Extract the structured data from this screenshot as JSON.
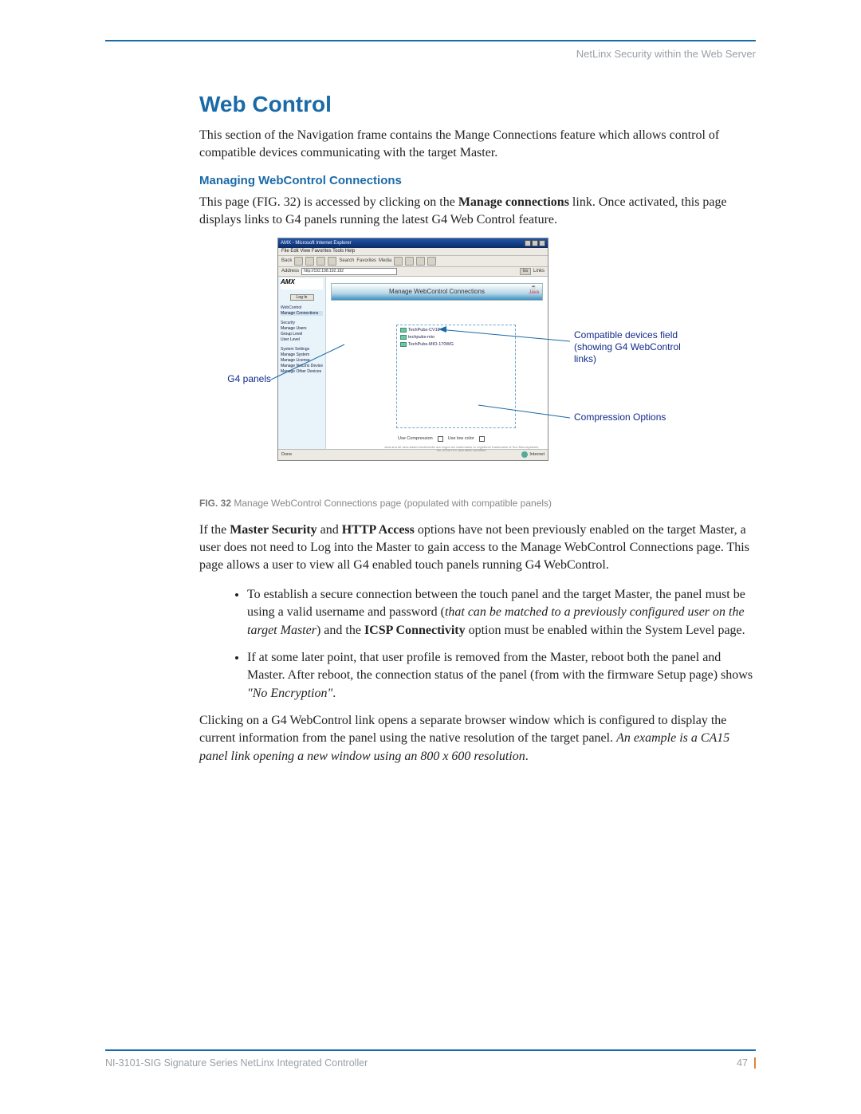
{
  "header": {
    "breadcrumb": "NetLinx Security within the Web Server"
  },
  "h1": "Web Control",
  "intro": "This section of the Navigation frame contains the Mange Connections feature which allows control of compatible devices communicating with the target Master.",
  "h2": "Managing WebControl Connections",
  "para2_pre": "This page (FIG. 32) is accessed by clicking on the ",
  "para2_bold": "Manage connections",
  "para2_post": " link. Once activated, this page displays links to G4 panels running the latest G4 Web Control feature.",
  "figure": {
    "browser": {
      "title": "AMX - Microsoft Internet Explorer",
      "menubar": "File   Edit   View   Favorites   Tools   Help",
      "toolbar_back": "Back",
      "toolbar_search": "Search",
      "toolbar_favorites": "Favorites",
      "toolbar_media": "Media",
      "address_label": "Address",
      "address_url": "http://192.198.192.192",
      "go": "Go",
      "links": "Links"
    },
    "page": {
      "logo": "AMX",
      "banner_title": "Manage WebControl Connections",
      "java_label": "Java",
      "left_login": "Log In",
      "left_section_web": "WebControl",
      "left_item_manage": "Manage Connections",
      "left_section_security": "Security",
      "left_items_security": [
        "Manage Users",
        "Group Level",
        "User Level"
      ],
      "left_section_system": "System Settings",
      "left_items_system": [
        "Manage System",
        "Manage License",
        "Manage NetLinx Devices",
        "Manage Other Devices"
      ],
      "devices": [
        "TechPubs-CV10",
        "techpubs-mio",
        "TechPubs-MIO-170WG"
      ],
      "compress_label_1": "Use Compression",
      "compress_label_2": "Use low color",
      "fineprint": "Java and all Java-based trademarks and logos are trademarks or registered trademarks of Sun Microsystems, Inc. in the U.S. and other countries."
    },
    "status": {
      "left": "Done",
      "right": "Internet"
    },
    "callouts": {
      "left": "G4 panels",
      "right1": "Compatible devices field (showing G4 WebControl links)",
      "right2": "Compression Options"
    },
    "caption_bold": "FIG. 32",
    "caption_text": "  Manage WebControl Connections page (populated with compatible panels)"
  },
  "para3": {
    "pre": "If the ",
    "b1": "Master Security",
    "mid1": " and ",
    "b2": "HTTP Access",
    "post": " options have not been previously enabled on the target Master, a user does not need to Log into the Master to gain access to the Manage WebControl Connections page. This page allows a user to view all G4 enabled touch panels running G4 WebControl."
  },
  "bullets": [
    {
      "pre": "To establish a secure connection between the touch panel and the target Master, the panel must be using a valid username and password (",
      "em1": "that can be matched to a previously configured user on the target Master",
      "mid": ") and the ",
      "b": "ICSP Connectivity",
      "post": " option must be enabled within the System Level page."
    },
    {
      "pre": "If at some later point, that user profile is removed from the Master, reboot both the panel and Master. After reboot, the connection status of the panel (from with the firmware Setup page) shows ",
      "em1": "\"No Encryption\"",
      "mid": ".",
      "b": "",
      "post": ""
    }
  ],
  "para4": {
    "pre": "Clicking on a G4 WebControl link opens a separate browser window which is configured to display the current information from the panel using the native resolution of the target panel. ",
    "em": "An example is a CA15 panel link opening a new window using an 800 x 600 resolution",
    "post": "."
  },
  "footer": {
    "left": "NI-3101-SIG Signature Series NetLinx Integrated Controller",
    "right": "47"
  }
}
